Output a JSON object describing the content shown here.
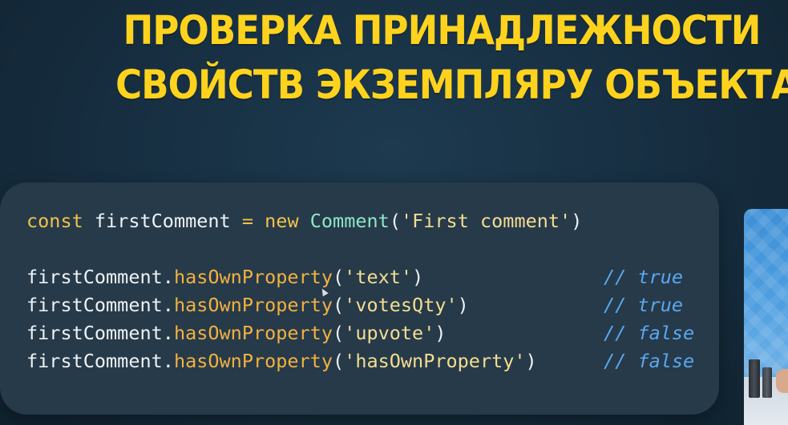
{
  "title": {
    "line1": "ПРОВЕРКА ПРИНАДЛЕЖНОСТИ",
    "line2": "СВОЙСТВ ЭКЗЕМПЛЯРУ ОБЪЕКТА"
  },
  "code": {
    "decl": {
      "keyword": "const",
      "variable": "firstComment",
      "operator": "=",
      "new_keyword": "new",
      "class_name": "Comment",
      "open_paren": "(",
      "argument": "'First comment'",
      "close_paren": ")"
    },
    "checks": [
      {
        "object": "firstComment",
        "dot": ".",
        "method": "hasOwnProperty",
        "open_paren": "(",
        "argument": "'text'",
        "close_paren": ")",
        "comment": "// true"
      },
      {
        "object": "firstComment",
        "dot": ".",
        "method": "hasOwnProperty",
        "open_paren": "(",
        "argument": "'votesQty'",
        "close_paren": ")",
        "comment": "// true"
      },
      {
        "object": "firstComment",
        "dot": ".",
        "method": "hasOwnProperty",
        "open_paren": "(",
        "argument": "'upvote'",
        "close_paren": ")",
        "comment": "// false"
      },
      {
        "object": "firstComment",
        "dot": ".",
        "method": "hasOwnProperty",
        "open_paren": "(",
        "argument": "'hasOwnProperty'",
        "close_paren": ")",
        "comment": "// false"
      }
    ]
  },
  "colors": {
    "title": "#ffd31d",
    "background": "#162d3f",
    "code_card": "#263a4a",
    "keyword": "#f0c34a",
    "class_name": "#8ee6c6",
    "string": "#f4dd8f",
    "method": "#f2b13f",
    "comment": "#5aa8ee"
  }
}
